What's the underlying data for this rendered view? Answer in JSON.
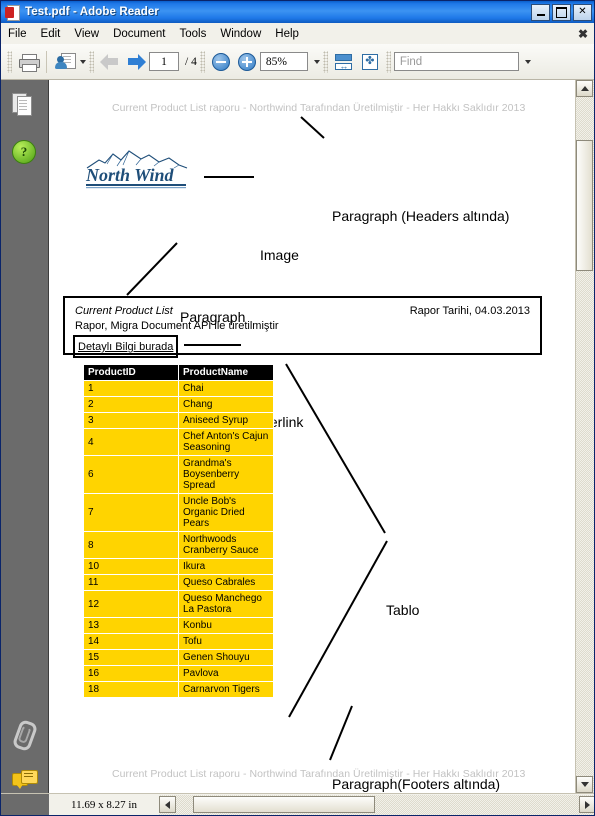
{
  "window": {
    "title": "Test.pdf - Adobe Reader",
    "icon": "pdf-icon",
    "minimize": "_",
    "maximize": "□",
    "close": "✕"
  },
  "menubar": {
    "items": [
      "File",
      "Edit",
      "View",
      "Document",
      "Tools",
      "Window",
      "Help"
    ],
    "close_doc": "✖"
  },
  "toolbar": {
    "print_label": "print-icon",
    "share_label": "share-icon",
    "prev_label": "previous-page-icon",
    "next_label": "next-page-icon",
    "page_current": "1",
    "page_total": "/ 4",
    "zoom_out_label": "zoom-out-icon",
    "zoom_in_label": "zoom-in-icon",
    "zoom_value": "85%",
    "fit_width_label": "fit-width-icon",
    "fit_page_label": "fit-page-icon",
    "find_placeholder": "Find",
    "find_value": ""
  },
  "navpane": {
    "items": [
      "pages-icon",
      "help-icon",
      "attachments-icon",
      "comments-icon"
    ]
  },
  "document": {
    "header_text": "Current Product List raporu - Northwind Tarafından Üretilmiştir - Her Hakkı Saklıdır 2013",
    "footer_text": "Current Product List raporu - Northwind Tarafından Üretilmiştir - Her Hakkı Saklıdır 2013",
    "logo_text": "North Wind",
    "box": {
      "title": "Current Product List",
      "date": "Rapor Tarihi, 04.03.2013",
      "subtitle": "Rapor, Migra Document API ile üretilmiştir",
      "link_text": "Detaylı Bilgi burada"
    }
  },
  "annotations": {
    "headers": "Paragraph (Headers altında)",
    "image": "Image",
    "paragraph": "Paragraph",
    "hyperlink": "Hyperlink",
    "tablo": "Tablo",
    "footers": "Paragraph(Footers altında)"
  },
  "table": {
    "columns": [
      "ProductID",
      "ProductName"
    ],
    "rows": [
      [
        "1",
        "Chai"
      ],
      [
        "2",
        "Chang"
      ],
      [
        "3",
        "Aniseed Syrup"
      ],
      [
        "4",
        "Chef Anton's Cajun Seasoning"
      ],
      [
        "6",
        "Grandma's Boysenberry Spread"
      ],
      [
        "7",
        "Uncle Bob's Organic Dried Pears"
      ],
      [
        "8",
        "Northwoods Cranberry Sauce"
      ],
      [
        "10",
        "Ikura"
      ],
      [
        "11",
        "Queso Cabrales"
      ],
      [
        "12",
        "Queso Manchego La Pastora"
      ],
      [
        "13",
        "Konbu"
      ],
      [
        "14",
        "Tofu"
      ],
      [
        "15",
        "Genen Shouyu"
      ],
      [
        "16",
        "Pavlova"
      ],
      [
        "18",
        "Carnarvon Tigers"
      ]
    ],
    "header_bg": "#000000",
    "header_fg": "#ffffff",
    "cell_bg": "#ffd400",
    "cell_fg": "#000000"
  },
  "statusbar": {
    "dimensions": "11.69 x 8.27 in"
  },
  "colors": {
    "titlebar": "#1e78e8",
    "navpane": "#6b6b6b",
    "table_yellow": "#ffd400",
    "logo_blue": "#1f4e79",
    "header_gray": "#c2c2c2"
  }
}
